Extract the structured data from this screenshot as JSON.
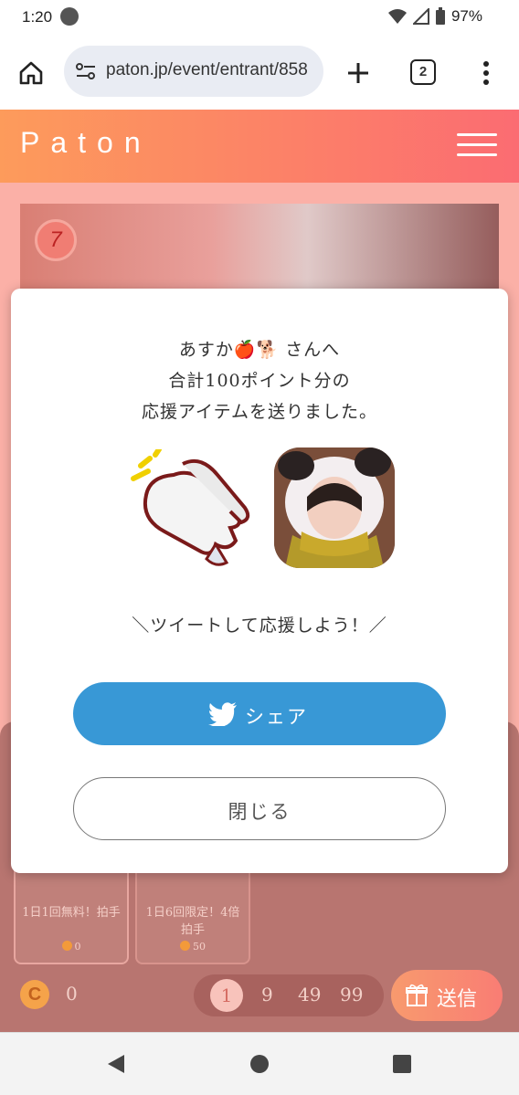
{
  "status_bar": {
    "time": "1:20",
    "battery": "97%"
  },
  "browser": {
    "url": "paton.jp/event/entrant/858",
    "tab_count": "2"
  },
  "site": {
    "logo": "Paton"
  },
  "photo_badge": "7",
  "modal": {
    "line1": "あすか🍎🐕 さんへ",
    "line2": "合計100ポイント分の",
    "line3": "応援アイテムを送りました。",
    "tweet_prompt": "＼ツイートして応援しよう！／",
    "share_label": "シェア",
    "close_label": "閉じる"
  },
  "items": [
    {
      "label": "1日1回無料！拍手",
      "cost": "0"
    },
    {
      "label": "1日6回限定！4倍拍手",
      "cost": "50"
    }
  ],
  "coins": {
    "symbol": "C",
    "count": "0"
  },
  "quantity_options": [
    "1",
    "9",
    "49",
    "99"
  ],
  "send_label": "送信",
  "colors": {
    "brand_gradient_start": "#fd9b5b",
    "brand_gradient_end": "#fb6c72",
    "share_blue": "#3898d6"
  },
  "icons": [
    "home-icon",
    "site-settings-icon",
    "new-tab-icon",
    "tabs-icon",
    "more-icon",
    "menu-icon",
    "twitter-icon",
    "gift-icon",
    "back-icon",
    "home-nav-icon",
    "recents-icon"
  ]
}
